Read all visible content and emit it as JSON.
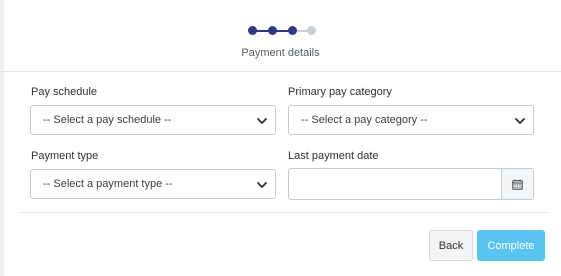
{
  "stepper": {
    "total_steps": 4,
    "completed_steps": 3,
    "active_color": "#2e3a87",
    "pending_color": "#c9cfd8",
    "title": "Payment details"
  },
  "form": {
    "pay_schedule": {
      "label": "Pay schedule",
      "value": "-- Select a pay schedule --"
    },
    "primary_pay_category": {
      "label": "Primary pay category",
      "value": "-- Select a pay category --"
    },
    "payment_type": {
      "label": "Payment type",
      "value": "-- Select a payment type --"
    },
    "last_payment_date": {
      "label": "Last payment date",
      "value": "",
      "icon": "calendar-icon"
    }
  },
  "actions": {
    "back_label": "Back",
    "complete_label": "Complete",
    "complete_color": "#59c3f2"
  }
}
